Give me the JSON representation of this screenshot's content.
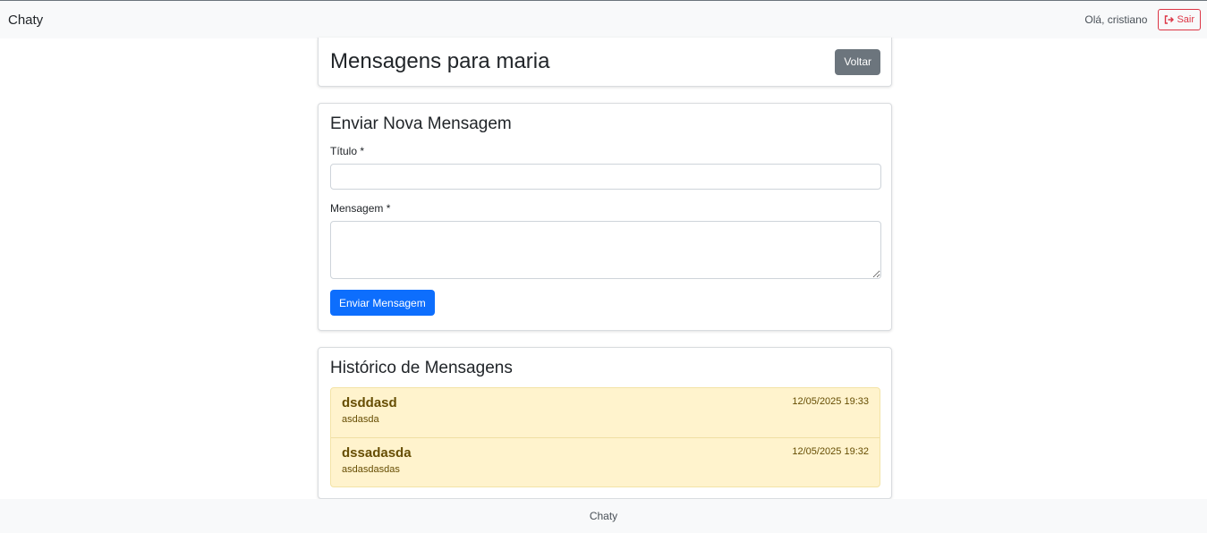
{
  "navbar": {
    "brand": "Chaty",
    "greeting": "Olá, cristiano",
    "logout_label": "Sair",
    "logout_icon": "sign-out-icon"
  },
  "header": {
    "title": "Mensagens para maria",
    "back_label": "Voltar"
  },
  "form": {
    "title": "Enviar Nova Mensagem",
    "title_label": "Título *",
    "title_value": "",
    "message_label": "Mensagem *",
    "message_value": "",
    "submit_label": "Enviar Mensagem"
  },
  "history": {
    "title": "Histórico de Mensagens",
    "messages": [
      {
        "title": "dsddasd",
        "body": "asdasda",
        "date": "12/05/2025 19:33"
      },
      {
        "title": "dssadasda",
        "body": "asdasdasdas",
        "date": "12/05/2025 19:32"
      }
    ]
  },
  "footer": {
    "text": "Chaty"
  },
  "colors": {
    "primary": "#0d6efd",
    "secondary": "#6c757d",
    "danger": "#dc3545",
    "warning_bg": "#fff3cd",
    "warning_text": "#664d03"
  }
}
